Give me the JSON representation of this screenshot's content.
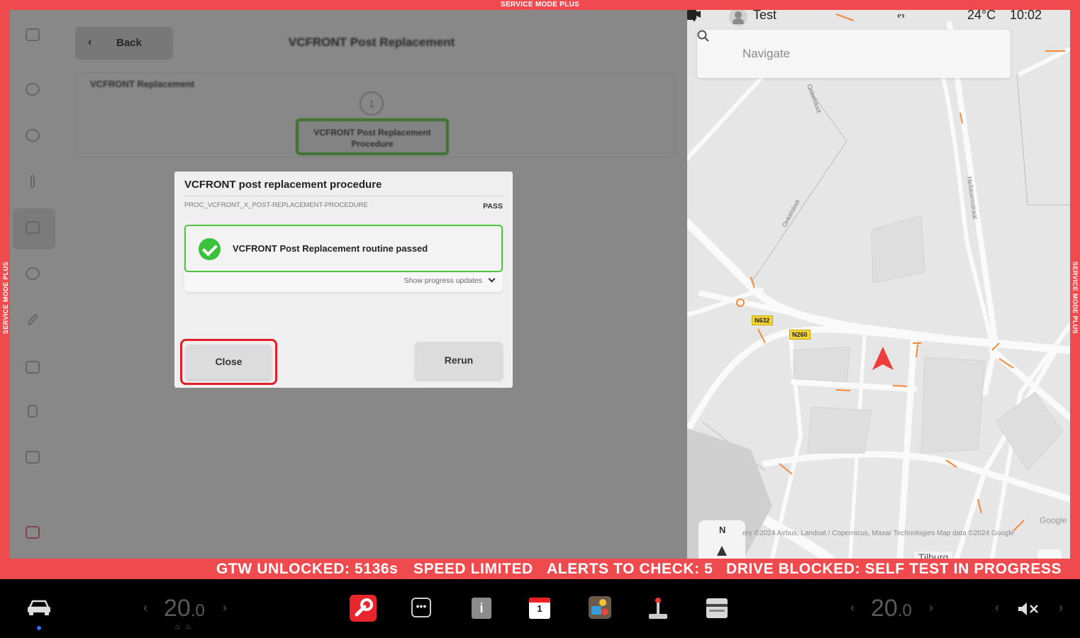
{
  "frame": {
    "top_label": "SERVICE MODE PLUS",
    "side_label": "SERVICE MODE PLUS",
    "status_items": [
      "GTW UNLOCKED: 5136s",
      "SPEED LIMITED",
      "ALERTS TO CHECK: 5",
      "DRIVE BLOCKED: SELF TEST IN PROGRESS"
    ],
    "accent_color": "#ef4b4e"
  },
  "service": {
    "back_label": "Back",
    "page_title": "VCFRONT Post Replacement",
    "section_label": "VCFRONT Replacement",
    "step_number": "1",
    "step_label": "VCFRONT Post Replacement Procedure"
  },
  "modal": {
    "title": "VCFRONT post replacement procedure",
    "code": "PROC_VCFRONT_X_POST-REPLACEMENT-PROCEDURE",
    "status": "PASS",
    "result_text": "VCFRONT Post Replacement routine passed",
    "progress_toggle": "Show progress updates",
    "close_label": "Close",
    "rerun_label": "Rerun",
    "pass_color": "#3cc13b",
    "highlight_color": "#e0202a"
  },
  "map": {
    "profile_name": "Test",
    "temperature": "24°C",
    "time": "10:02",
    "search_placeholder": "Navigate",
    "road_shields": [
      "N632",
      "N260"
    ],
    "streets": [
      "Onkelsloot",
      "Onkelsloot",
      "Helbloemstraat"
    ],
    "compass_label": "N",
    "attribution": "ery ©2024 Airbus, Landsat / Copernicus, Maxar Technologies Map data ©2024 Google",
    "google_mark": "Google",
    "city": "Tilburg"
  },
  "taskbar": {
    "left_temp_main": "20",
    "left_temp_dec": ".0",
    "right_temp_main": "20",
    "right_temp_dec": ".0",
    "arrow_left": "‹",
    "arrow_right": "›",
    "dots_label": "•••",
    "manual_label": "i",
    "calendar_day": "1"
  }
}
